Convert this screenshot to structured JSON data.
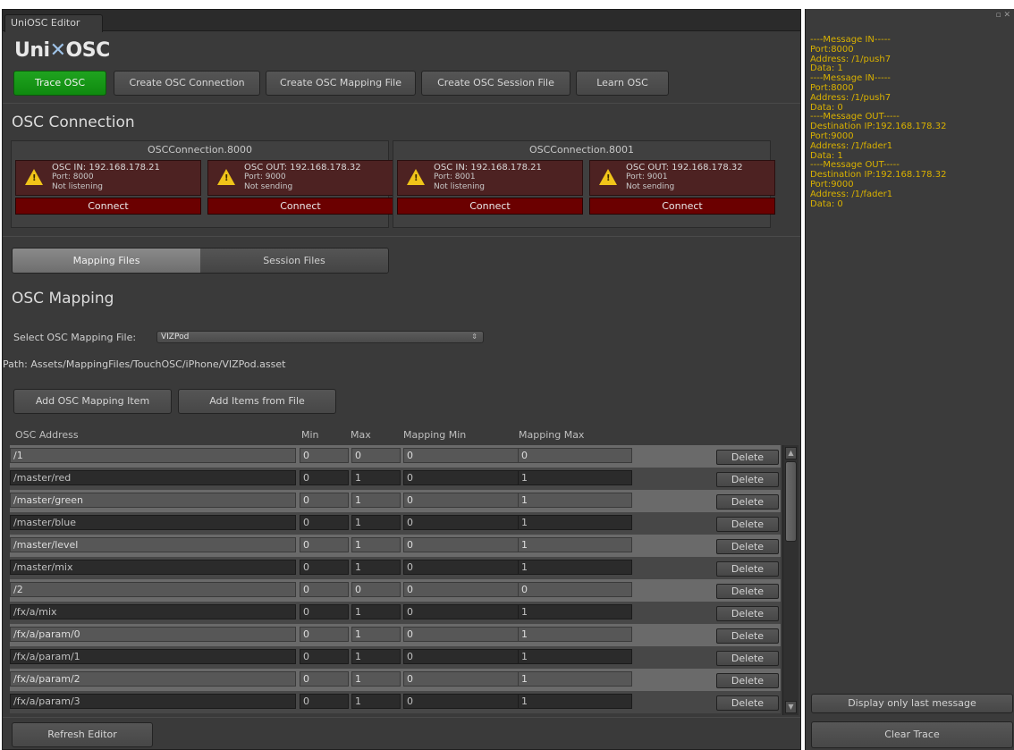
{
  "window": {
    "tab_title": "UniOSC Editor"
  },
  "logo": {
    "prefix": "Uni",
    "x_glyph": "✕",
    "suffix": "OSC"
  },
  "toolbar": {
    "trace_osc": "Trace OSC",
    "create_connection": "Create OSC Connection",
    "create_mapping_file": "Create OSC Mapping File",
    "create_session_file": "Create OSC Session File",
    "learn_osc": "Learn OSC"
  },
  "connection_section": {
    "title": "OSC Connection",
    "connections": [
      {
        "name": "OSCConnection.8000",
        "in": {
          "line1": "OSC IN: 192.168.178.21",
          "line2": "Port: 8000",
          "status": "Not listening",
          "button": "Connect"
        },
        "out": {
          "line1": "OSC OUT: 192.168.178.32",
          "line2": "Port: 9000",
          "status": "Not sending",
          "button": "Connect"
        }
      },
      {
        "name": "OSCConnection.8001",
        "in": {
          "line1": "OSC IN: 192.168.178.21",
          "line2": "Port: 8001",
          "status": "Not listening",
          "button": "Connect"
        },
        "out": {
          "line1": "OSC OUT: 192.168.178.32",
          "line2": "Port: 9001",
          "status": "Not sending",
          "button": "Connect"
        }
      }
    ],
    "warning_glyph": "!"
  },
  "file_tabs": {
    "mapping": "Mapping Files",
    "session": "Session Files",
    "active": "mapping"
  },
  "mapping": {
    "title": "OSC Mapping",
    "select_label": "Select OSC Mapping File:",
    "selected_file": "VIZPod",
    "select_arrow": "⇕",
    "path": "Path: Assets/MappingFiles/TouchOSC/iPhone/VIZPod.asset",
    "add_item": "Add OSC Mapping Item",
    "add_from_file": "Add Items from File",
    "columns": {
      "address": "OSC Address",
      "min": "Min",
      "max": "Max",
      "mapping_min": "Mapping Min",
      "mapping_max": "Mapping Max"
    },
    "delete_label": "Delete",
    "rows": [
      {
        "address": "/1",
        "min": "0",
        "max": "0",
        "mmin": "0",
        "mmax": "0"
      },
      {
        "address": "/master/red",
        "min": "0",
        "max": "1",
        "mmin": "0",
        "mmax": "1"
      },
      {
        "address": "/master/green",
        "min": "0",
        "max": "1",
        "mmin": "0",
        "mmax": "1"
      },
      {
        "address": "/master/blue",
        "min": "0",
        "max": "1",
        "mmin": "0",
        "mmax": "1"
      },
      {
        "address": "/master/level",
        "min": "0",
        "max": "1",
        "mmin": "0",
        "mmax": "1"
      },
      {
        "address": "/master/mix",
        "min": "0",
        "max": "1",
        "mmin": "0",
        "mmax": "1"
      },
      {
        "address": "/2",
        "min": "0",
        "max": "0",
        "mmin": "0",
        "mmax": "0"
      },
      {
        "address": "/fx/a/mix",
        "min": "0",
        "max": "1",
        "mmin": "0",
        "mmax": "1"
      },
      {
        "address": "/fx/a/param/0",
        "min": "0",
        "max": "1",
        "mmin": "0",
        "mmax": "1"
      },
      {
        "address": "/fx/a/param/1",
        "min": "0",
        "max": "1",
        "mmin": "0",
        "mmax": "1"
      },
      {
        "address": "/fx/a/param/2",
        "min": "0",
        "max": "1",
        "mmin": "0",
        "mmax": "1"
      },
      {
        "address": "/fx/a/param/3",
        "min": "0",
        "max": "1",
        "mmin": "0",
        "mmax": "1"
      }
    ],
    "scroll_up": "▲",
    "scroll_down": "▼"
  },
  "footer": {
    "refresh": "Refresh Editor"
  },
  "trace_panel": {
    "window_controls": "▫ ✕",
    "messages": [
      "----Message IN-----",
      "Port:8000",
      "Address: /1/push7",
      "Data: 1",
      "----Message IN-----",
      "Port:8000",
      "Address: /1/push7",
      "Data: 0",
      "----Message OUT-----",
      "Destination IP:192.168.178.32",
      "Port:9000",
      "Address: /1/fader1",
      "Data: 1",
      "----Message OUT-----",
      "Destination IP:192.168.178.32",
      "Port:9000",
      "Address: /1/fader1",
      "Data: 0"
    ],
    "display_last": "Display only last message",
    "clear_trace": "Clear Trace"
  },
  "colors": {
    "trace_text": "#d9b100",
    "green_button": "#139313",
    "connect_button": "#6b0000",
    "warning": "#f0c419"
  }
}
